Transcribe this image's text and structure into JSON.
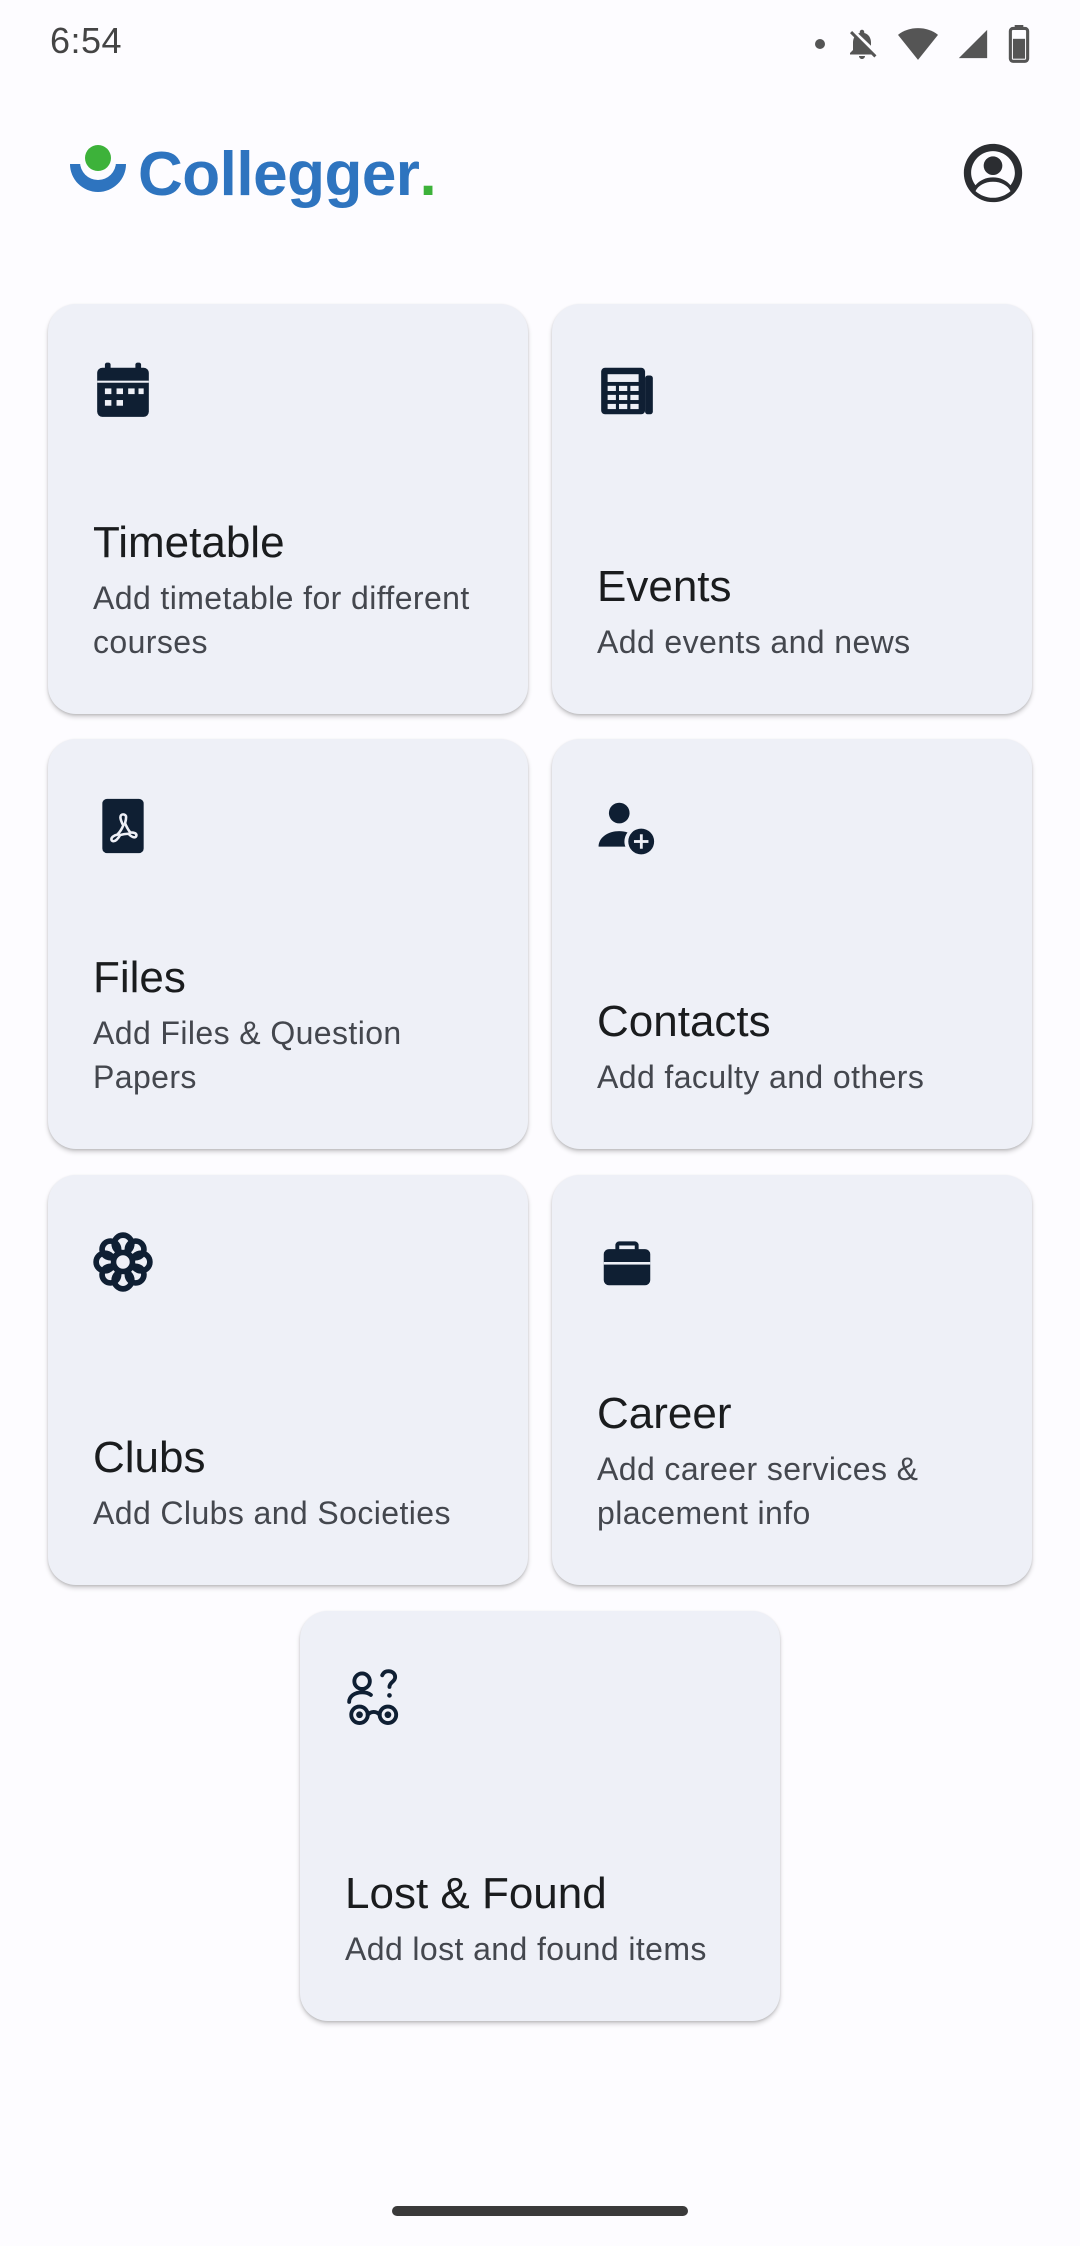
{
  "status_bar": {
    "time": "6:54",
    "icons": [
      "dot-icon",
      "bell-off-icon",
      "wifi-icon",
      "signal-icon",
      "battery-icon"
    ]
  },
  "header": {
    "logo_text": "Collegger",
    "logo_dot": ".",
    "brand_color": "#2e74bf",
    "accent_color": "#3db23a",
    "profile_icon": "account-circle-icon"
  },
  "cards": [
    {
      "title": "Timetable",
      "subtitle": "Add timetable for different courses",
      "icon": "calendar-icon"
    },
    {
      "title": "Events",
      "subtitle": "Add events and news",
      "icon": "newspaper-icon"
    },
    {
      "title": "Files",
      "subtitle": "Add Files & Question Papers",
      "icon": "pdf-file-icon"
    },
    {
      "title": "Contacts",
      "subtitle": "Add faculty and others",
      "icon": "person-add-icon"
    },
    {
      "title": "Clubs",
      "subtitle": "Add Clubs and Societies",
      "icon": "flower-icon"
    },
    {
      "title": "Career",
      "subtitle": "Add career services & placement info",
      "icon": "briefcase-icon"
    },
    {
      "title": "Lost & Found",
      "subtitle": "Add lost and found items",
      "icon": "lost-found-icon"
    }
  ]
}
